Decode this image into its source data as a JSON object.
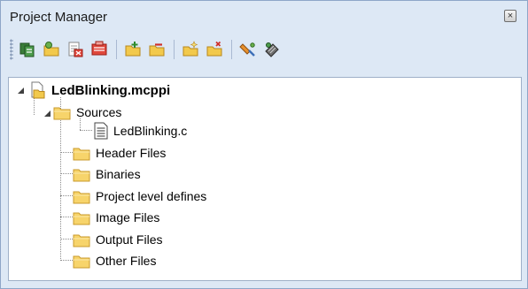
{
  "panel": {
    "title": "Project Manager",
    "close_glyph": "×"
  },
  "toolbar": {
    "buttons": [
      {
        "icon": "copy-files-icon"
      },
      {
        "icon": "folder-open-icon"
      },
      {
        "icon": "remove-files-icon"
      },
      {
        "icon": "remove-all-icon"
      },
      {
        "icon": "add-folder-icon"
      },
      {
        "icon": "remove-folder-icon"
      },
      {
        "icon": "new-file-icon"
      },
      {
        "icon": "delete-file-icon"
      },
      {
        "icon": "compile-icon"
      },
      {
        "icon": "program-icon"
      }
    ]
  },
  "tree": {
    "root": {
      "label": "LedBlinking.mcppi",
      "expanded": true
    },
    "items": [
      {
        "label": "Sources",
        "type": "folder",
        "expanded": true
      },
      {
        "label": "LedBlinking.c",
        "type": "file"
      },
      {
        "label": "Header Files",
        "type": "folder"
      },
      {
        "label": "Binaries",
        "type": "folder"
      },
      {
        "label": "Project level defines",
        "type": "folder"
      },
      {
        "label": "Image Files",
        "type": "folder"
      },
      {
        "label": "Output Files",
        "type": "folder"
      },
      {
        "label": "Other Files",
        "type": "folder"
      }
    ]
  },
  "colors": {
    "panel_bg": "#dde8f5",
    "folder": "#f7d46b",
    "folder_edge": "#c99a2b"
  }
}
